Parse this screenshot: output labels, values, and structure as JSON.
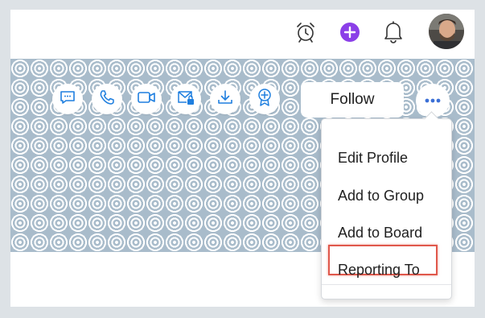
{
  "topbar": {
    "icons": [
      "alarm-clock-icon",
      "add-icon",
      "bell-icon"
    ],
    "accent_add": "#8b3fe8",
    "avatar": "user-avatar"
  },
  "banner": {
    "pattern_colors": [
      "#a9bccb",
      "#ffffff"
    ]
  },
  "actions": {
    "icons": [
      "message-icon",
      "phone-icon",
      "video-call-icon",
      "mail-lock-icon",
      "download-icon",
      "award-badge-icon"
    ],
    "icon_color": "#1f7fdf"
  },
  "follow": {
    "label": "Follow"
  },
  "more": {
    "icon": "more-dots-icon",
    "color": "#3b6fd6"
  },
  "menu": {
    "items": [
      {
        "label": "Edit Profile"
      },
      {
        "label": "Add to Group"
      },
      {
        "label": "Add to Board"
      },
      {
        "label": "Reporting To",
        "highlighted": true
      }
    ],
    "highlight_color": "#e0584b"
  }
}
